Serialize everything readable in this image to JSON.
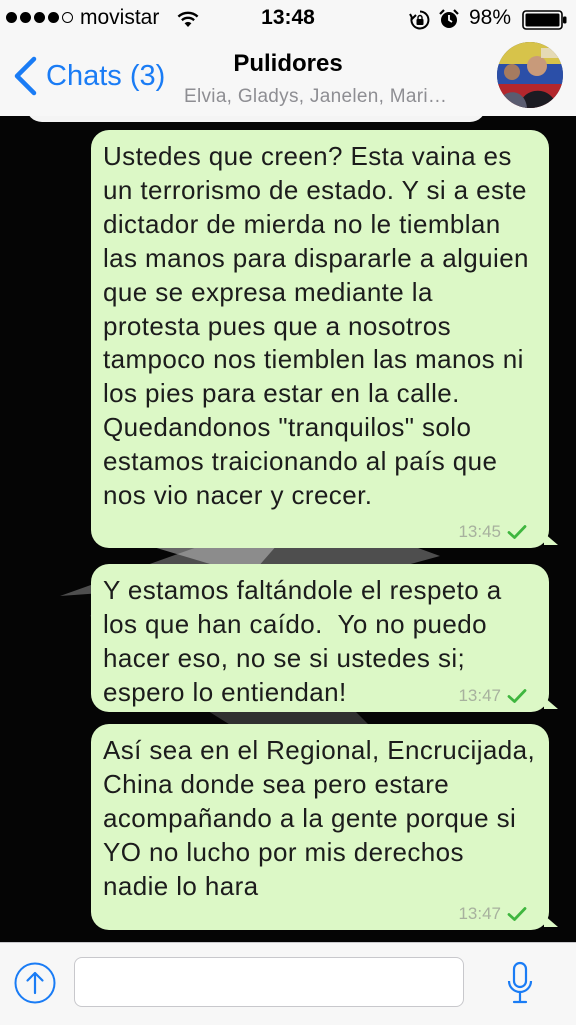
{
  "status_bar": {
    "carrier": "movistar",
    "time": "13:48",
    "battery_percent": "98%",
    "signal_bars_filled": 4,
    "signal_bars_total": 5,
    "icons": [
      "wifi-icon",
      "rotation-lock-icon",
      "alarm-icon",
      "battery-icon"
    ]
  },
  "nav": {
    "back_label": "Chats (3)",
    "title": "Pulidores",
    "members": "Elvia, Gladys, Janelen, Mari…"
  },
  "messages": [
    {
      "text": "Ustedes que creen? Esta vaina es un terrorismo de estado. Y si a este dictador de mierda no le tiemblan las manos para dispararle a alguien que se expresa mediante la protesta pues que a nosotros tampoco nos tiemblen las manos ni los pies para estar en la calle. Quedandonos \"tranquilos\" solo estamos traicionando al país que nos vio nacer y crecer.",
      "time": "13:45",
      "status": "sent-check"
    },
    {
      "text": "Y estamos faltándole el respeto a los que han caído.  Yo no puedo hacer eso, no se si ustedes si; espero lo entiendan!",
      "time": "13:47",
      "status": "sent-check"
    },
    {
      "text": "Así sea en el Regional, Encrucijada, China donde sea pero estare acompañando a la gente porque si YO no lucho por mis derechos nadie lo hara",
      "time": "13:47",
      "status": "sent-check"
    }
  ],
  "composer": {
    "placeholder": "",
    "icons": [
      "share-icon",
      "microphone-icon"
    ]
  },
  "colors": {
    "accent": "#1a7cf5",
    "bubble_outgoing": "#dcf8c6",
    "check": "#3fb63f",
    "bar_background": "#f7f7f7",
    "chat_background": "#050505"
  }
}
